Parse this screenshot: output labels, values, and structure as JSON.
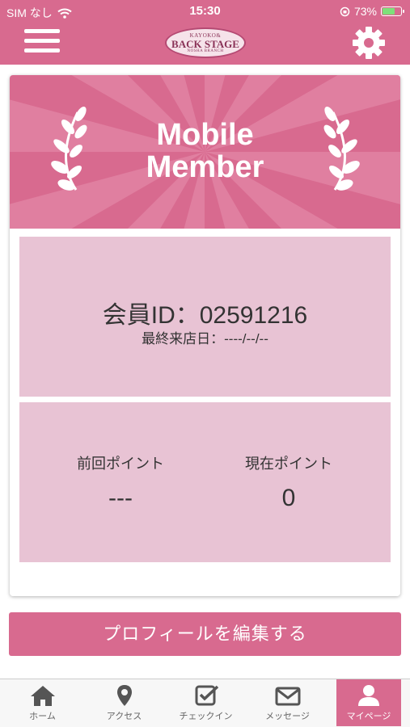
{
  "status_bar": {
    "carrier": "SIM なし",
    "time": "15:30",
    "battery_pct": "73%",
    "battery_fill": 0.73
  },
  "header": {
    "logo_top": "KAYOKO&",
    "logo_main": "BACK STAGE",
    "logo_sub": "NOSHA BRANCH"
  },
  "banner": {
    "title_line1": "Mobile",
    "title_line2": "Member"
  },
  "member": {
    "id_text": "会員ID：02591216",
    "last_visit": "最終来店日：----/--/--"
  },
  "points": {
    "previous_label": "前回ポイント",
    "previous_value": "---",
    "current_label": "現在ポイント",
    "current_value": "0"
  },
  "edit_profile_label": "プロフィールを編集する",
  "tabs": [
    {
      "label": "ホーム",
      "icon": "home-icon"
    },
    {
      "label": "アクセス",
      "icon": "map-pin-icon"
    },
    {
      "label": "チェックイン",
      "icon": "checkbox-icon"
    },
    {
      "label": "メッセージ",
      "icon": "envelope-icon"
    },
    {
      "label": "マイページ",
      "icon": "user-icon",
      "active": true
    }
  ],
  "colors": {
    "brand_pink": "#d86a8f",
    "panel_pink": "#e8c3d4"
  }
}
